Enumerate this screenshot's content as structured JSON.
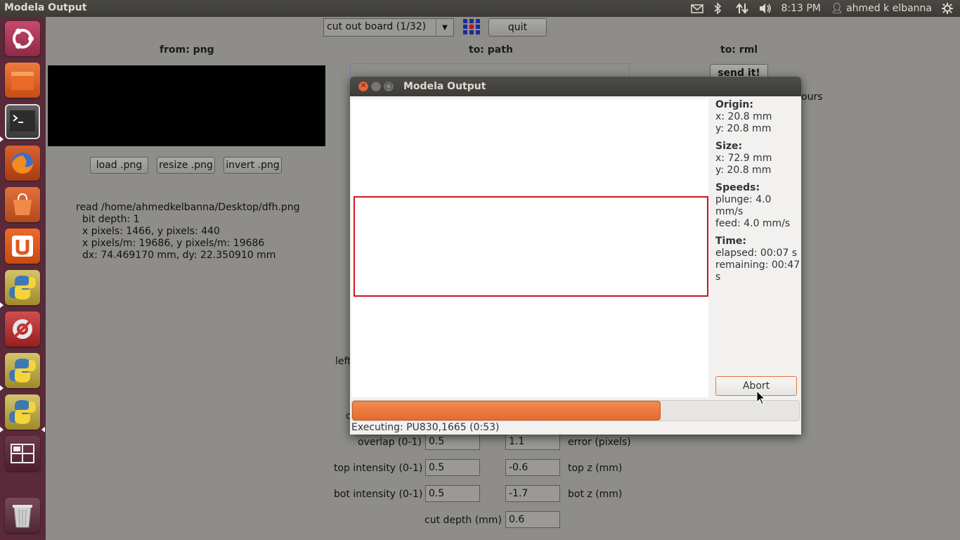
{
  "top_panel": {
    "app_title": "Modela Output",
    "clock": "8:13 PM",
    "user": "ahmed k elbanna",
    "icons": [
      "mail-icon",
      "bluetooth-icon",
      "network-icon",
      "volume-icon",
      "gear-icon"
    ]
  },
  "launcher": {
    "items": [
      "ubuntu-home-icon",
      "files-icon",
      "terminal-icon",
      "firefox-icon",
      "software-center-icon",
      "ubuntu-one-icon",
      "python-icon",
      "system-settings-icon",
      "python-icon",
      "python-icon",
      "workspace-switcher-icon",
      "trash-icon"
    ]
  },
  "background_app": {
    "process_select": "cut out board (1/32)",
    "quit_label": "quit",
    "from_header": "from: png",
    "to_path_header": "to: path",
    "to_rml_header": "to: rml",
    "send_label": "send it!",
    "hours_fragment": "ours",
    "load_label": "load .png",
    "resize_label": "resize .png",
    "invert_label": "invert .png",
    "info_lines": [
      "read /home/ahmedkelbanna/Desktop/dfh.png",
      "bit depth: 1",
      "x pixels: 1466, y pixels: 440",
      "x pixels/m: 19686, y pixels/m: 19686",
      "dx: 74.469170 mm, dy: 22.350910 mm"
    ],
    "left_fragment": "left",
    "c_fragment": "c",
    "overlap_label": "overlap (0-1)",
    "overlap_value": "0.5",
    "error_value": "1.1",
    "error_label": "error (pixels)",
    "top_intensity_label": "top intensity (0-1)",
    "top_intensity_value": "0.5",
    "top_z_value": "-0.6",
    "top_z_label": "top z (mm)",
    "bot_intensity_label": "bot intensity (0-1)",
    "bot_intensity_value": "0.5",
    "bot_z_value": "-1.7",
    "bot_z_label": "bot z (mm)",
    "cut_depth_label": "cut depth (mm)",
    "cut_depth_value": "0.6"
  },
  "dialog": {
    "title": "Modela Output",
    "origin_header": "Origin:",
    "origin_x": "x: 20.8 mm",
    "origin_y": "y: 20.8 mm",
    "size_header": "Size:",
    "size_x": "x: 72.9 mm",
    "size_y": "y: 20.8 mm",
    "speeds_header": "Speeds:",
    "plunge": "plunge: 4.0 mm/s",
    "feed": "feed: 4.0 mm/s",
    "time_header": "Time:",
    "elapsed": "elapsed: 00:07 s",
    "remaining": "remaining: 00:47 s",
    "abort_label": "Abort",
    "progress_fraction": 0.69,
    "status": "Executing: PU830,1665 (0:53)",
    "accent_color": "#e56b30",
    "path_color": "#d1141e"
  }
}
